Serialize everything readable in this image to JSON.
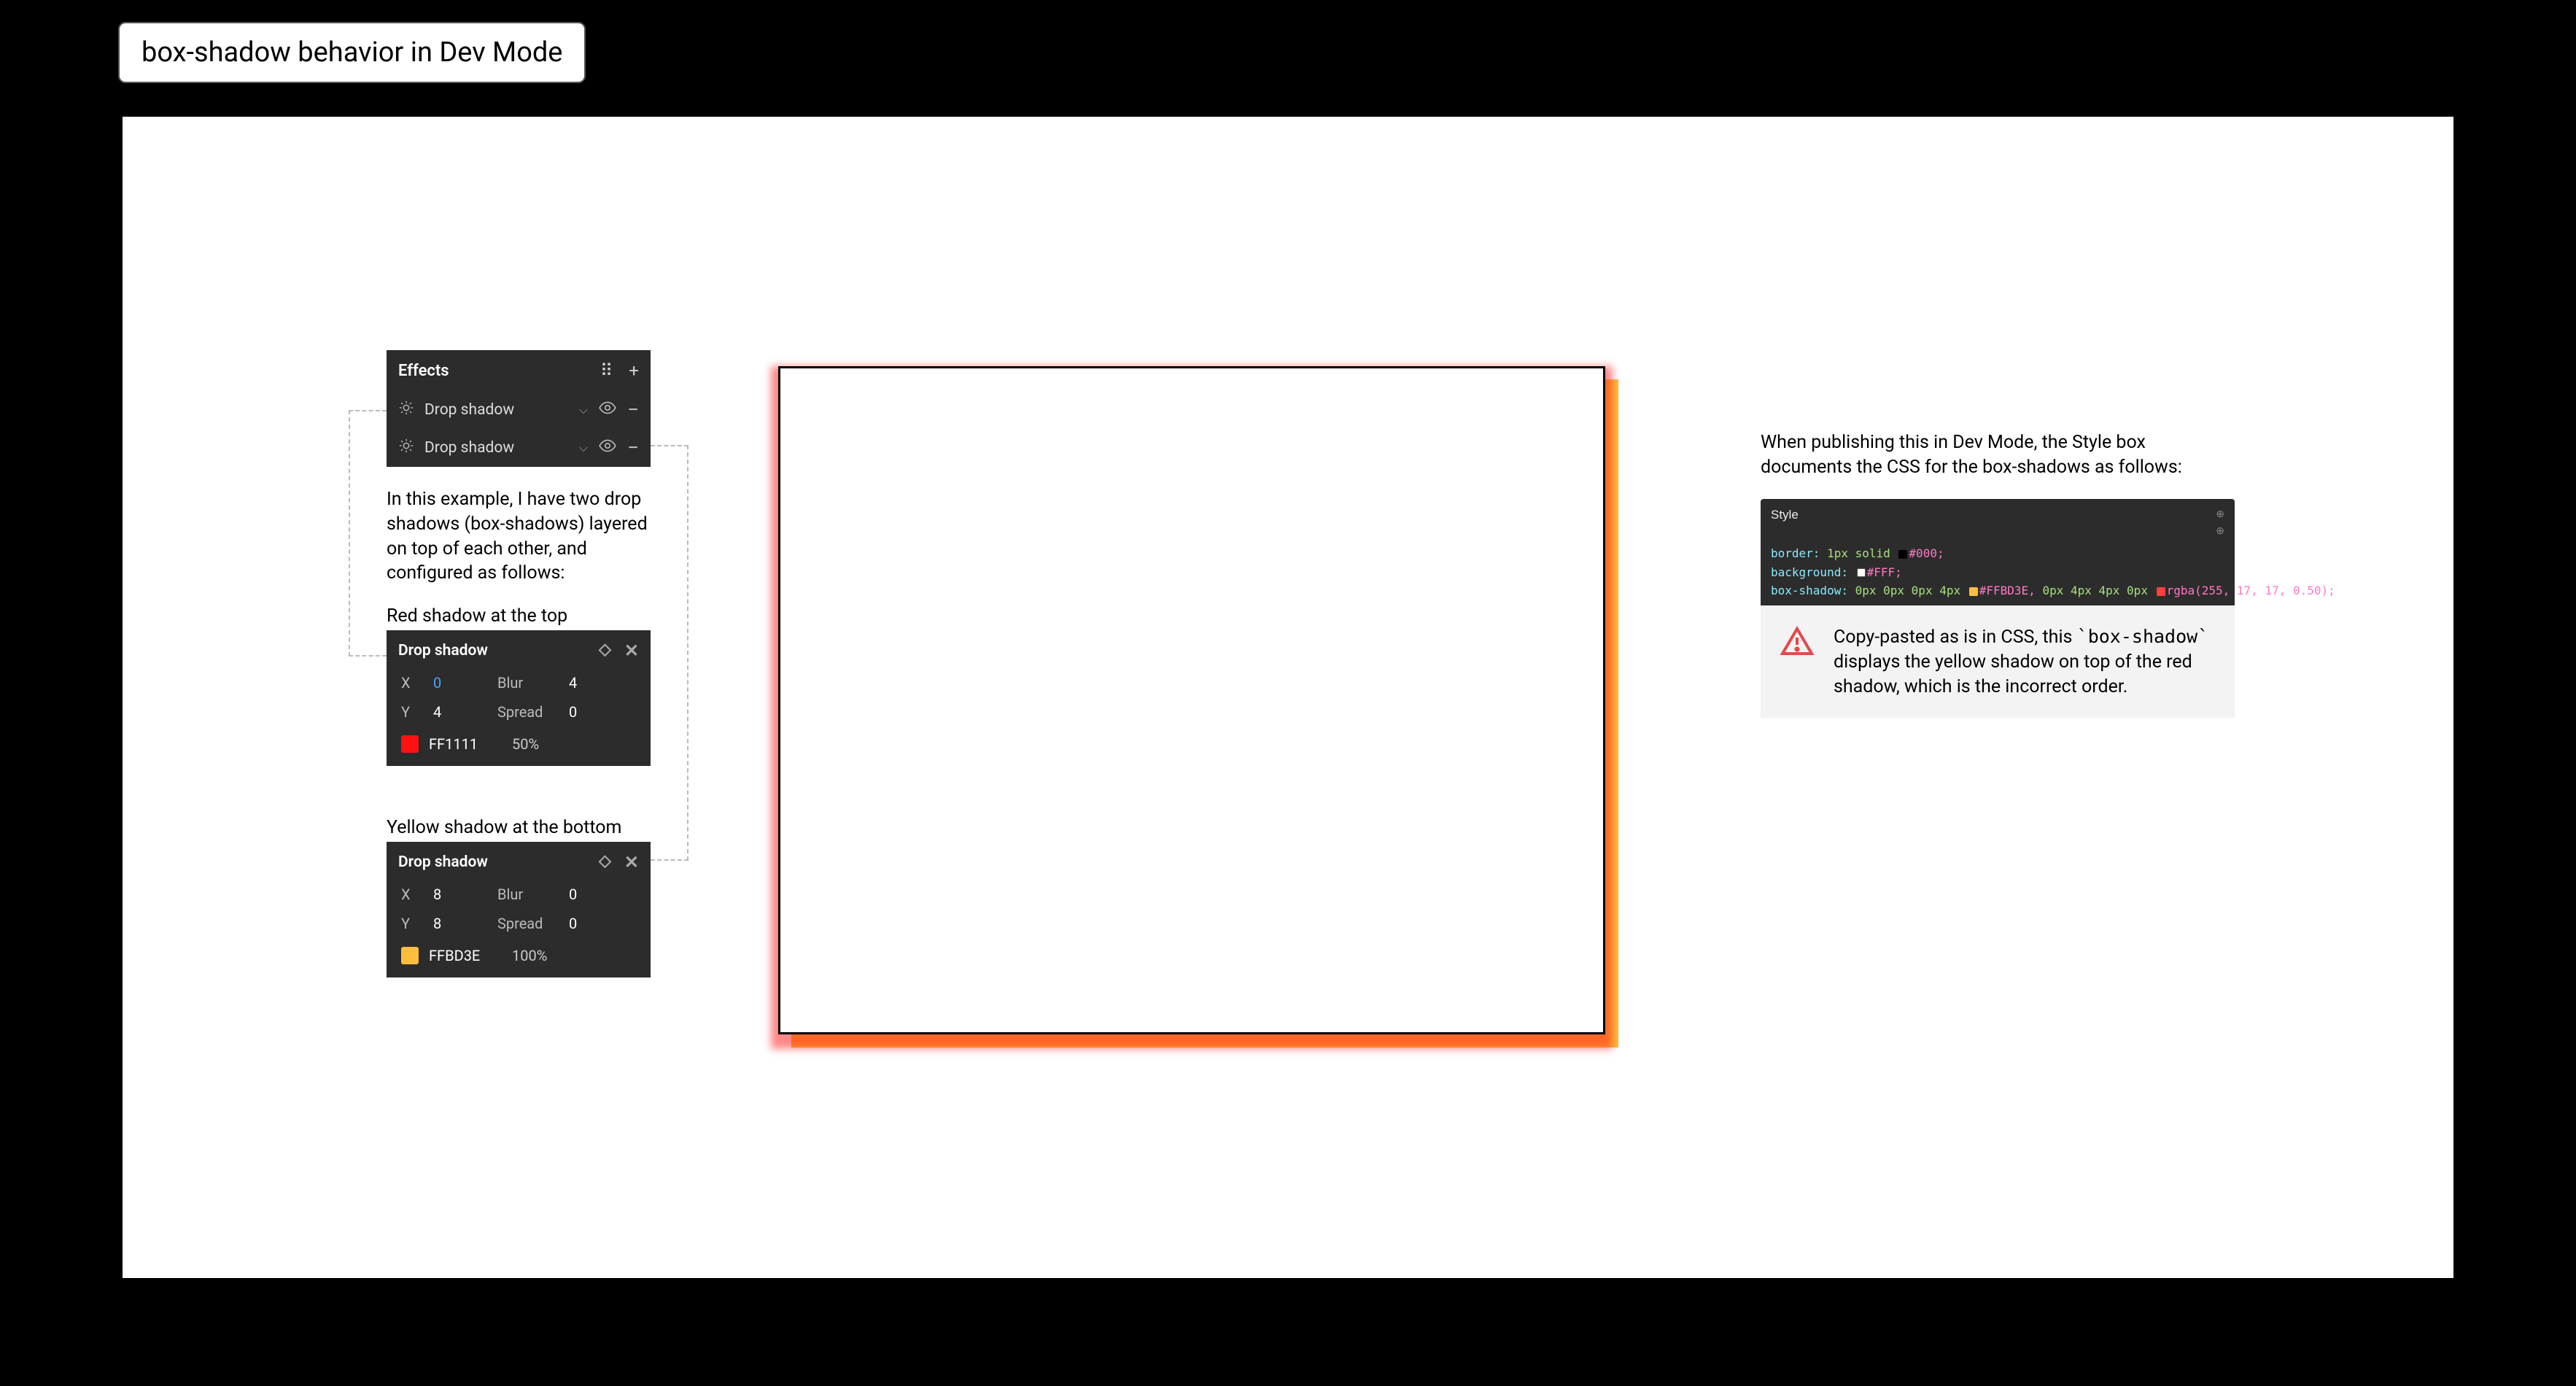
{
  "frame_title": "box-shadow behavior in Dev Mode",
  "effects": {
    "header": "Effects",
    "rows": [
      {
        "label": "Drop shadow"
      },
      {
        "label": "Drop shadow"
      }
    ]
  },
  "intro_text": "In this example, I have two drop shadows (box-shadows) layered on top of each other, and configured as follows:",
  "red_panel": {
    "caption": "Red shadow at the top",
    "title": "Drop shadow",
    "x_label": "X",
    "x_value": "0",
    "y_label": "Y",
    "y_value": "4",
    "blur_label": "Blur",
    "blur_value": "4",
    "spread_label": "Spread",
    "spread_value": "0",
    "hex": "FF1111",
    "opacity": "50%"
  },
  "yellow_panel": {
    "caption": "Yellow shadow at the bottom",
    "title": "Drop shadow",
    "x_label": "X",
    "x_value": "8",
    "y_label": "Y",
    "y_value": "8",
    "blur_label": "Blur",
    "blur_value": "0",
    "spread_label": "Spread",
    "spread_value": "0",
    "hex": "FFBD3E",
    "opacity": "100%"
  },
  "right_intro": "When publishing this in Dev Mode, the Style box documents the CSS for the box-shadows as follows:",
  "code": {
    "title": "Style",
    "line1_prop": "border:",
    "line1_val": "1px solid",
    "line1_col": "#000;",
    "line2_prop": "background:",
    "line2_col": "#FFF;",
    "line3_prop": "box-shadow:",
    "line3_a": "0px 0px 0px 4px",
    "line3_a_col": "#FFBD3E,",
    "line3_b": "0px 4px 4px 0px",
    "line3_b_col": "rgba(255, 17, 17, 0.50);"
  },
  "callout_text_1": "Copy-pasted as is in CSS, this ",
  "callout_code": "`box-shadow`",
  "callout_text_2": " displays the yellow shadow on top of the red shadow, which is the incorrect order."
}
